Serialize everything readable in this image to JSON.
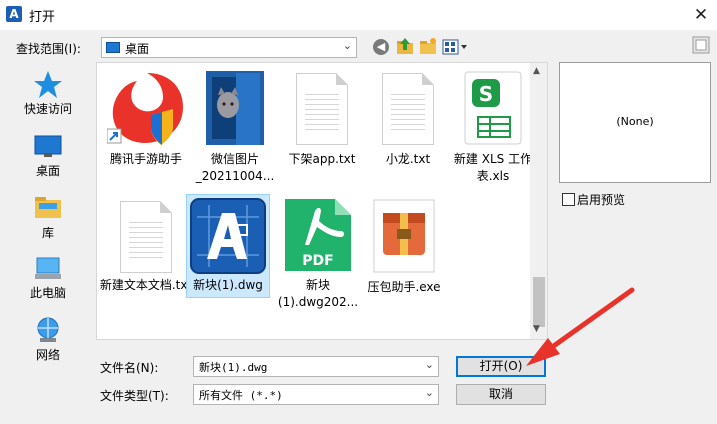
{
  "window": {
    "title": "打开",
    "close": "✕"
  },
  "lookin": {
    "label": "查找范围(I):",
    "value": "桌面"
  },
  "places": [
    {
      "label": "快速访问"
    },
    {
      "label": "桌面"
    },
    {
      "label": "库"
    },
    {
      "label": "此电脑"
    },
    {
      "label": "网络"
    }
  ],
  "files": [
    {
      "name": "腾讯手游助手",
      "icon": "tencent-game-helper-icon"
    },
    {
      "name": "微信图片_20211004...",
      "icon": "photo-thumbnail"
    },
    {
      "name": "下架app.txt",
      "icon": "text-file-icon"
    },
    {
      "name": "小龙.txt",
      "icon": "text-file-icon"
    },
    {
      "name": "新建 XLS 工作表.xls",
      "icon": "wps-spreadsheet-icon"
    },
    {
      "name": "新建文本文档.txt",
      "icon": "text-file-icon"
    },
    {
      "name": "新块(1).dwg",
      "icon": "autocad-dwg-icon"
    },
    {
      "name": "新块(1).dwg202...",
      "icon": "pdf-icon"
    },
    {
      "name": "压包助手.exe",
      "icon": "archive-tool-icon"
    }
  ],
  "preview": {
    "text": "(None)",
    "enable_label": "启用预览"
  },
  "filename": {
    "label": "文件名(N):",
    "value": "新块(1).dwg"
  },
  "filetype": {
    "label": "文件类型(T):",
    "value": "所有文件 (*.*)"
  },
  "buttons": {
    "open": "打开(O)",
    "cancel": "取消"
  },
  "colors": {
    "accent": "#0078d7",
    "selection": "#cce8ff",
    "arrow": "#e8322a"
  }
}
